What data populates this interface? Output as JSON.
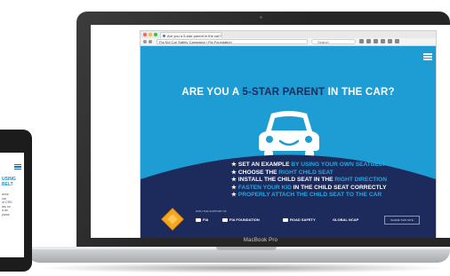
{
  "browser": {
    "tab_title": "Are you a 5-star parent in the car?",
    "url": "Fia Kid Car Safety Campaign | Fia Foundation",
    "search_placeholder": "Search"
  },
  "site": {
    "headline_before": "ARE YOU A ",
    "headline_accent": "5-STAR PARENT",
    "headline_after": " IN THE CAR?",
    "checklist": [
      {
        "star": "★",
        "parts": [
          "SET AN EXAMPLE ",
          "BY USING YOUR OWN SEATBELT"
        ]
      },
      {
        "star": "★",
        "parts": [
          "CHOOSE THE ",
          "RIGHT CHILD SEAT"
        ]
      },
      {
        "star": "★",
        "parts": [
          "INSTALL THE CHILD SEAT IN THE ",
          "RIGHT DIRECTION"
        ]
      },
      {
        "star": "★",
        "parts": [
          "FASTEN YOUR KID",
          " IN THE CHILD SEAT CORRECTLY"
        ]
      },
      {
        "star": "★",
        "parts": [
          "PROPERLY ATTACH THE CHILD SEAT TO THE CAR",
          ""
        ]
      }
    ],
    "partners_caption": "WITH THE SUPPORT OF",
    "partners": [
      "FIA",
      "FIA FOUNDATION",
      "ROAD SAFETY",
      "GLOBAL NCAP"
    ],
    "partner_box": "SHARE THIS SITE"
  },
  "laptop": {
    "brand": "MacBook Pro"
  },
  "phone": {
    "headline_lines": [
      "USING",
      "BELT"
    ],
    "body_lines": [
      "ance",
      "",
      "car",
      "of CRS",
      "ats on",
      "d as",
      "plane"
    ]
  },
  "colors": {
    "site_blue": "#1e9dd4",
    "navy": "#1c2a5c",
    "accent_blue": "#29a8e0",
    "diamond_orange": "#f6a71b"
  },
  "icons": [
    "car-smile-icon",
    "hamburger-menu-icon",
    "road-sign-diamond-icon"
  ]
}
